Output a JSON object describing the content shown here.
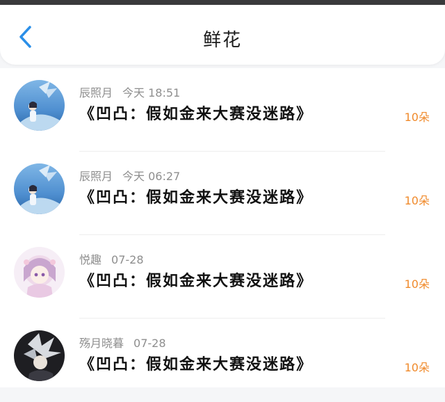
{
  "header": {
    "title": "鲜花",
    "back_icon": "chevron-left-icon",
    "accent_color": "#2b8fe8"
  },
  "list": {
    "count_color": "#f08a2b",
    "items": [
      {
        "name": "辰照月",
        "time": "今天 18:51",
        "work": "《凹凸：假如金来大赛没迷路》",
        "count": "10朵",
        "avatar": "anime-avatar-blue-winged"
      },
      {
        "name": "辰照月",
        "time": "今天 06:27",
        "work": "《凹凸：假如金来大赛没迷路》",
        "count": "10朵",
        "avatar": "anime-avatar-blue-winged"
      },
      {
        "name": "悦趣",
        "time": "07-28",
        "work": "《凹凸：假如金来大赛没迷路》",
        "count": "10朵",
        "avatar": "anime-avatar-pink-girl"
      },
      {
        "name": "殇月晓暮",
        "time": "07-28",
        "work": "《凹凸：假如金来大赛没迷路》",
        "count": "10朵",
        "avatar": "anime-avatar-dark-silver"
      }
    ]
  }
}
